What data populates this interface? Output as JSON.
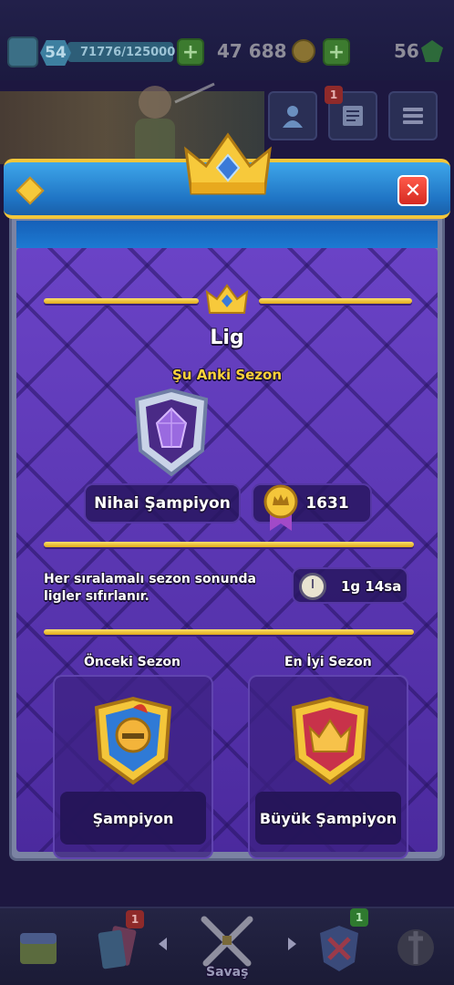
{
  "top_bar": {
    "level": "54",
    "xp": "71776/125000",
    "gold": "47 688",
    "gems": "56"
  },
  "top_buttons": {
    "news_badge": "1"
  },
  "modal": {
    "title": "Lig",
    "current_season_label": "Şu Anki Sezon",
    "current_league_name": "Nihai Şampiyon",
    "trophies": "1631",
    "reset_info": "Her sıralamalı sezon sonunda ligler sıfırlanır.",
    "time_left": "1g 14sa",
    "previous_season": {
      "label": "Önceki Sezon",
      "league": "Şampiyon"
    },
    "best_season": {
      "label": "En İyi Sezon",
      "league": "Büyük Şampiyon"
    }
  },
  "bottom_nav": {
    "cards_badge": "1",
    "battle_label": "Savaş",
    "clan_badge": "1"
  },
  "colors": {
    "header_blue": "#1f74c4",
    "gold_accent": "#f4c63a",
    "panel_purple": "#5a36b0",
    "season_highlight": "#ffd23a",
    "close_red": "#d52a22"
  }
}
